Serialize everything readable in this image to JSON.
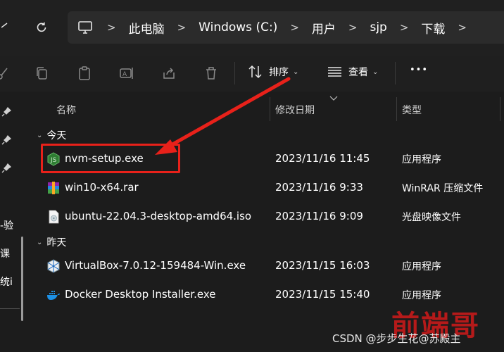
{
  "nav": {
    "back_icon": "partial-arrow-icon",
    "refresh_icon": "refresh-icon"
  },
  "breadcrumb": {
    "items": [
      "此电脑",
      "Windows (C:)",
      "用户",
      "sjp",
      "下载"
    ],
    "separator": ">"
  },
  "toolbar": {
    "sort_label": "排序",
    "view_label": "查看",
    "more_label": "•••"
  },
  "sidebar": {
    "labels": [
      "-验",
      "课",
      "统i"
    ]
  },
  "columns": {
    "name": "名称",
    "date": "修改日期",
    "type": "类型"
  },
  "groups": [
    {
      "label": "今天",
      "files": [
        {
          "name": "nvm-setup.exe",
          "date": "2023/11/16 11:45",
          "type": "应用程序",
          "icon": "nodejs-icon"
        },
        {
          "name": "win10-x64.rar",
          "date": "2023/11/16 9:33",
          "type": "WinRAR 压缩文件",
          "icon": "winrar-icon"
        },
        {
          "name": "ubuntu-22.04.3-desktop-amd64.iso",
          "date": "2023/11/16 9:09",
          "type": "光盘映像文件",
          "icon": "disc-image-icon"
        }
      ]
    },
    {
      "label": "昨天",
      "files": [
        {
          "name": "VirtualBox-7.0.12-159484-Win.exe",
          "date": "2023/11/15 16:03",
          "type": "应用程序",
          "icon": "virtualbox-icon"
        },
        {
          "name": "Docker Desktop Installer.exe",
          "date": "2023/11/15 15:40",
          "type": "应用程序",
          "icon": "docker-icon"
        }
      ]
    }
  ],
  "annotation": {
    "color": "#e8211a"
  },
  "watermark": {
    "csdn": "CSDN @步步生花@苏殿主",
    "seal": "前端哥"
  },
  "colors": {
    "background": "#1c1c1c",
    "topbar": "#202020",
    "address": "#2b2b2b",
    "text": "#ffffff"
  }
}
